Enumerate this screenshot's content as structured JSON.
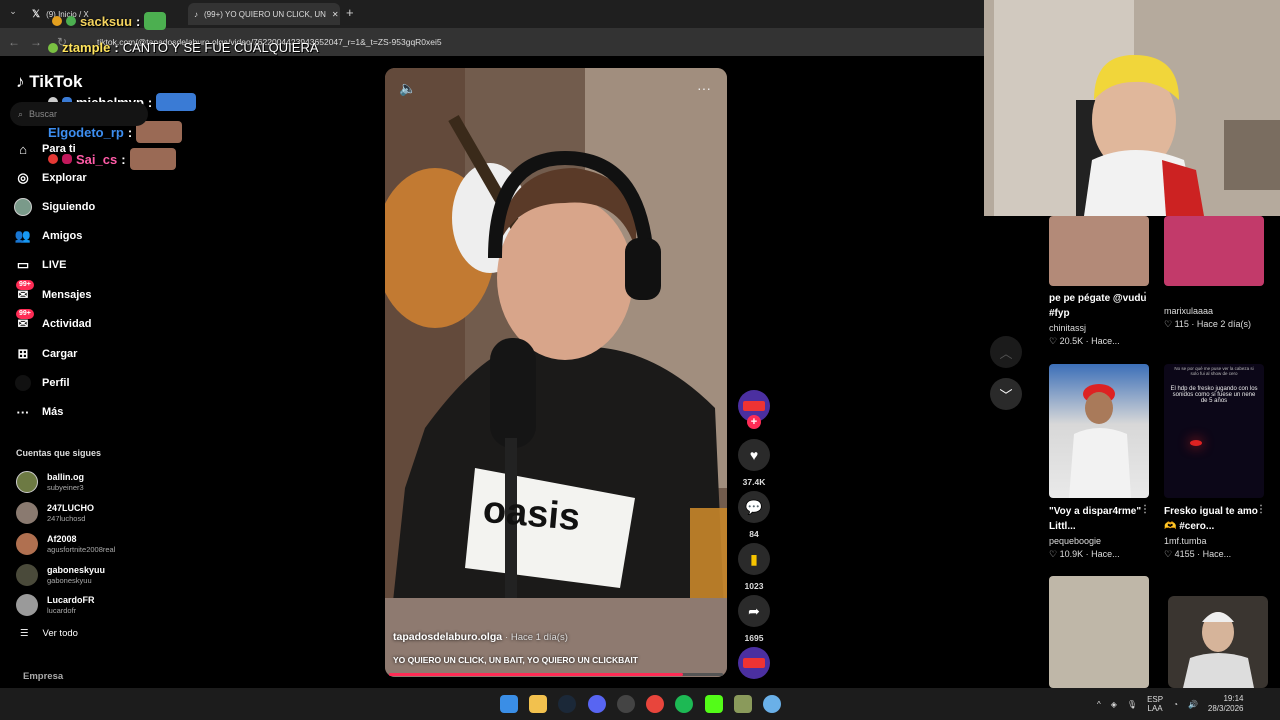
{
  "browser": {
    "tabs": [
      {
        "label": "(9) Inicio / X"
      },
      {
        "label": "(99+) YO QUIERO UN CLICK, UN"
      }
    ],
    "url": "tiktok.com/@tapadosdelaburo.olga/video/7622004423943652047_r=1&_t=ZS-953gqR0xei5"
  },
  "chat": {
    "messages": [
      {
        "user": "sacksuu",
        "text": ""
      },
      {
        "user": "ztample",
        "text": "CANTO Y SE FUE CUALQUIERA"
      },
      {
        "user": "michelmvp",
        "text": ""
      },
      {
        "user": "Elgodeto_rp",
        "text": ""
      },
      {
        "user": "Sai_cs",
        "text": ""
      }
    ]
  },
  "sidebar": {
    "logo": "TikTok",
    "search_placeholder": "Buscar",
    "items": [
      {
        "label": "Para ti",
        "icon": "home-icon"
      },
      {
        "label": "Explorar",
        "icon": "compass-icon"
      },
      {
        "label": "Siguiendo",
        "icon": "following-icon"
      },
      {
        "label": "Amigos",
        "icon": "friends-icon"
      },
      {
        "label": "LIVE",
        "icon": "live-icon"
      },
      {
        "label": "Mensajes",
        "icon": "messages-icon",
        "badge": "99+"
      },
      {
        "label": "Actividad",
        "icon": "activity-icon",
        "badge": "99+"
      },
      {
        "label": "Cargar",
        "icon": "upload-icon"
      },
      {
        "label": "Perfil",
        "icon": "profile-icon"
      },
      {
        "label": "Más",
        "icon": "more-icon"
      }
    ],
    "following_title": "Cuentas que sigues",
    "following": [
      {
        "name": "ballin.og",
        "handle": "subyeiner3"
      },
      {
        "name": "247LUCHO",
        "handle": "247luchosd"
      },
      {
        "name": "Af2008",
        "handle": "agusfortnite2008real"
      },
      {
        "name": "gaboneskyuu",
        "handle": "gaboneskyuu"
      },
      {
        "name": "LucardoFR",
        "handle": "lucardofr"
      }
    ],
    "see_all": "Ver todo",
    "company": "Empresa"
  },
  "video": {
    "username": "tapadosdelaburo.olga",
    "time": "· Hace 1 día(s)",
    "caption": "YO QUIERO UN CLICK, UN BAIT, YO QUIERO UN CLICKBAIT",
    "shirt_text": "oasis",
    "progress": 0.88
  },
  "actions": {
    "likes": "37.4K",
    "comments": "84",
    "saves": "1023",
    "shares": "1695"
  },
  "right_videos": [
    {
      "title": "pe pe pégate @vudu #fyp",
      "author": "chinitassj",
      "stats": "20.5K · Hace..."
    },
    {
      "title": "",
      "author": "marixulaaaa",
      "stats": "115 · Hace 2 día(s)"
    },
    {
      "title": "\"Voy a dispar4rme\" Littl...",
      "author": "pequeboogie",
      "stats": "10.9K · Hace..."
    },
    {
      "title": "Fresko igual te amo🫶 #cero...",
      "author": "1mf.tumba",
      "stats": "4155 · Hace..."
    }
  ],
  "thumb_text": "El hdp de fresko jugando con los sonidos como si fuese un nene de 5 años",
  "thumb_text_top": "No se por qué me puse ver la cabeza si solo fui al show de cero",
  "taskbar": {
    "lang": "ESP",
    "region": "LAA",
    "time": "19:14",
    "date": "28/3/2026"
  },
  "colors": {
    "accent": "#fe2c55",
    "background": "#000000"
  }
}
